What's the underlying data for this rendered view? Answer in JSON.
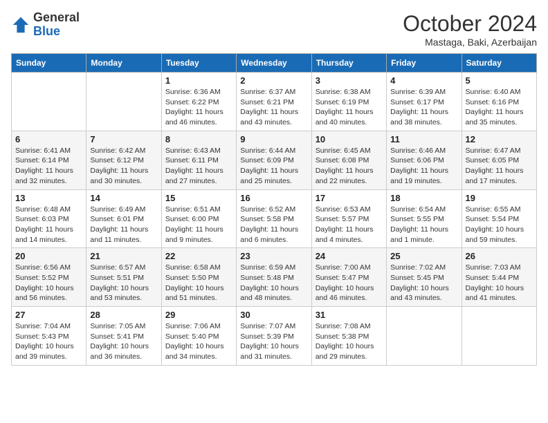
{
  "header": {
    "logo_line1": "General",
    "logo_line2": "Blue",
    "month_title": "October 2024",
    "subtitle": "Mastaga, Baki, Azerbaijan"
  },
  "weekdays": [
    "Sunday",
    "Monday",
    "Tuesday",
    "Wednesday",
    "Thursday",
    "Friday",
    "Saturday"
  ],
  "weeks": [
    [
      {
        "day": "",
        "info": ""
      },
      {
        "day": "",
        "info": ""
      },
      {
        "day": "1",
        "info": "Sunrise: 6:36 AM\nSunset: 6:22 PM\nDaylight: 11 hours and 46 minutes."
      },
      {
        "day": "2",
        "info": "Sunrise: 6:37 AM\nSunset: 6:21 PM\nDaylight: 11 hours and 43 minutes."
      },
      {
        "day": "3",
        "info": "Sunrise: 6:38 AM\nSunset: 6:19 PM\nDaylight: 11 hours and 40 minutes."
      },
      {
        "day": "4",
        "info": "Sunrise: 6:39 AM\nSunset: 6:17 PM\nDaylight: 11 hours and 38 minutes."
      },
      {
        "day": "5",
        "info": "Sunrise: 6:40 AM\nSunset: 6:16 PM\nDaylight: 11 hours and 35 minutes."
      }
    ],
    [
      {
        "day": "6",
        "info": "Sunrise: 6:41 AM\nSunset: 6:14 PM\nDaylight: 11 hours and 32 minutes."
      },
      {
        "day": "7",
        "info": "Sunrise: 6:42 AM\nSunset: 6:12 PM\nDaylight: 11 hours and 30 minutes."
      },
      {
        "day": "8",
        "info": "Sunrise: 6:43 AM\nSunset: 6:11 PM\nDaylight: 11 hours and 27 minutes."
      },
      {
        "day": "9",
        "info": "Sunrise: 6:44 AM\nSunset: 6:09 PM\nDaylight: 11 hours and 25 minutes."
      },
      {
        "day": "10",
        "info": "Sunrise: 6:45 AM\nSunset: 6:08 PM\nDaylight: 11 hours and 22 minutes."
      },
      {
        "day": "11",
        "info": "Sunrise: 6:46 AM\nSunset: 6:06 PM\nDaylight: 11 hours and 19 minutes."
      },
      {
        "day": "12",
        "info": "Sunrise: 6:47 AM\nSunset: 6:05 PM\nDaylight: 11 hours and 17 minutes."
      }
    ],
    [
      {
        "day": "13",
        "info": "Sunrise: 6:48 AM\nSunset: 6:03 PM\nDaylight: 11 hours and 14 minutes."
      },
      {
        "day": "14",
        "info": "Sunrise: 6:49 AM\nSunset: 6:01 PM\nDaylight: 11 hours and 11 minutes."
      },
      {
        "day": "15",
        "info": "Sunrise: 6:51 AM\nSunset: 6:00 PM\nDaylight: 11 hours and 9 minutes."
      },
      {
        "day": "16",
        "info": "Sunrise: 6:52 AM\nSunset: 5:58 PM\nDaylight: 11 hours and 6 minutes."
      },
      {
        "day": "17",
        "info": "Sunrise: 6:53 AM\nSunset: 5:57 PM\nDaylight: 11 hours and 4 minutes."
      },
      {
        "day": "18",
        "info": "Sunrise: 6:54 AM\nSunset: 5:55 PM\nDaylight: 11 hours and 1 minute."
      },
      {
        "day": "19",
        "info": "Sunrise: 6:55 AM\nSunset: 5:54 PM\nDaylight: 10 hours and 59 minutes."
      }
    ],
    [
      {
        "day": "20",
        "info": "Sunrise: 6:56 AM\nSunset: 5:52 PM\nDaylight: 10 hours and 56 minutes."
      },
      {
        "day": "21",
        "info": "Sunrise: 6:57 AM\nSunset: 5:51 PM\nDaylight: 10 hours and 53 minutes."
      },
      {
        "day": "22",
        "info": "Sunrise: 6:58 AM\nSunset: 5:50 PM\nDaylight: 10 hours and 51 minutes."
      },
      {
        "day": "23",
        "info": "Sunrise: 6:59 AM\nSunset: 5:48 PM\nDaylight: 10 hours and 48 minutes."
      },
      {
        "day": "24",
        "info": "Sunrise: 7:00 AM\nSunset: 5:47 PM\nDaylight: 10 hours and 46 minutes."
      },
      {
        "day": "25",
        "info": "Sunrise: 7:02 AM\nSunset: 5:45 PM\nDaylight: 10 hours and 43 minutes."
      },
      {
        "day": "26",
        "info": "Sunrise: 7:03 AM\nSunset: 5:44 PM\nDaylight: 10 hours and 41 minutes."
      }
    ],
    [
      {
        "day": "27",
        "info": "Sunrise: 7:04 AM\nSunset: 5:43 PM\nDaylight: 10 hours and 39 minutes."
      },
      {
        "day": "28",
        "info": "Sunrise: 7:05 AM\nSunset: 5:41 PM\nDaylight: 10 hours and 36 minutes."
      },
      {
        "day": "29",
        "info": "Sunrise: 7:06 AM\nSunset: 5:40 PM\nDaylight: 10 hours and 34 minutes."
      },
      {
        "day": "30",
        "info": "Sunrise: 7:07 AM\nSunset: 5:39 PM\nDaylight: 10 hours and 31 minutes."
      },
      {
        "day": "31",
        "info": "Sunrise: 7:08 AM\nSunset: 5:38 PM\nDaylight: 10 hours and 29 minutes."
      },
      {
        "day": "",
        "info": ""
      },
      {
        "day": "",
        "info": ""
      }
    ]
  ]
}
